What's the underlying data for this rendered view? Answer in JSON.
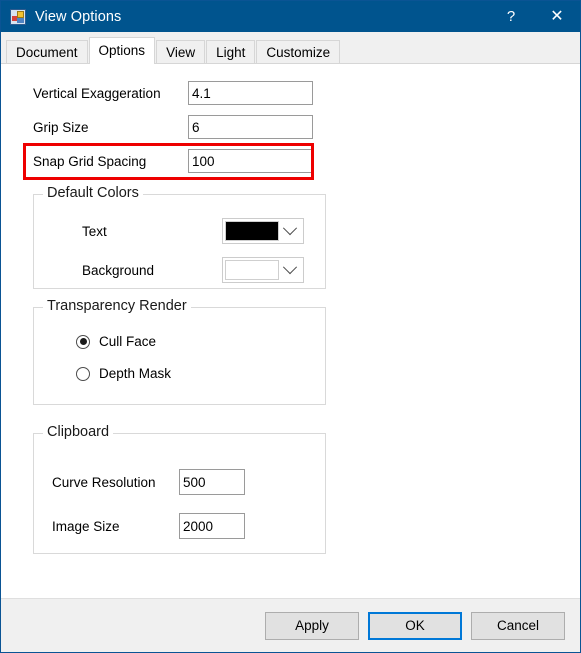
{
  "window": {
    "title": "View Options",
    "icon": "app-window-icon",
    "help_label": "?",
    "close_label": "✕"
  },
  "tabs": [
    {
      "label": "Document",
      "active": false
    },
    {
      "label": "Options",
      "active": true
    },
    {
      "label": "View",
      "active": false
    },
    {
      "label": "Light",
      "active": false
    },
    {
      "label": "Customize",
      "active": false
    }
  ],
  "options_tab": {
    "fields": [
      {
        "label": "Vertical Exaggeration",
        "value": "4.1"
      },
      {
        "label": "Grip Size",
        "value": "6"
      },
      {
        "label": "Snap Grid Spacing",
        "value": "100"
      }
    ],
    "highlight_color": "#ee0000",
    "default_colors": {
      "title": "Default Colors",
      "text_label": "Text",
      "text_color": "#000000",
      "background_label": "Background",
      "background_color": "#ffffff"
    },
    "transparency_render": {
      "title": "Transparency Render",
      "options": [
        {
          "label": "Cull Face",
          "selected": true
        },
        {
          "label": "Depth Mask",
          "selected": false
        }
      ]
    },
    "clipboard": {
      "title": "Clipboard",
      "fields": [
        {
          "label": "Curve Resolution",
          "value": "500"
        },
        {
          "label": "Image Size",
          "value": "2000"
        }
      ]
    }
  },
  "footer": {
    "apply_label": "Apply",
    "ok_label": "OK",
    "cancel_label": "Cancel",
    "default_button": "OK",
    "accent_color": "#0078d7"
  }
}
